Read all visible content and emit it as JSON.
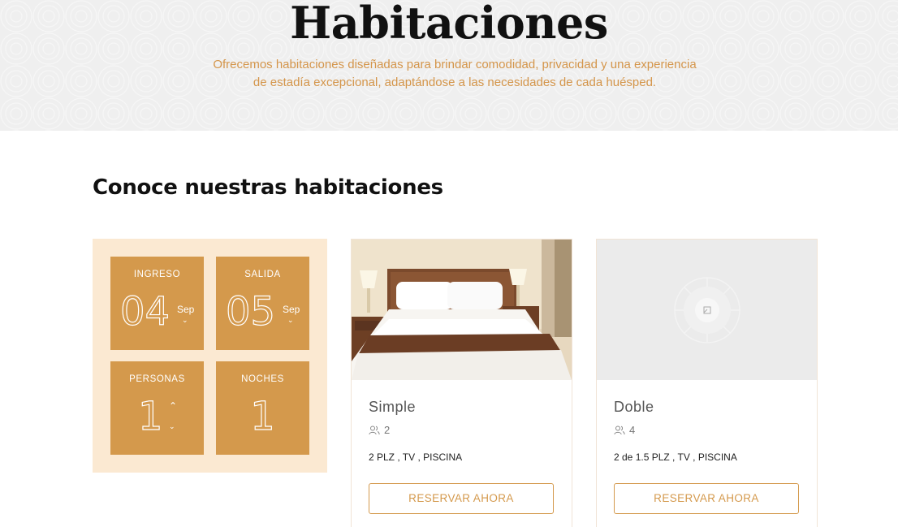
{
  "hero": {
    "title": "Habitaciones",
    "subtitle_line1": "Ofrecemos habitaciones diseñadas para brindar comodidad, privacidad y una experiencia",
    "subtitle_line2": "de estadía excepcional, adaptándose a las necesidades de cada huésped."
  },
  "section": {
    "title": "Conoce nuestras habitaciones"
  },
  "booking": {
    "checkin": {
      "label": "INGRESO",
      "day": "04",
      "month": "Sep"
    },
    "checkout": {
      "label": "SALIDA",
      "day": "05",
      "month": "Sep"
    },
    "guests": {
      "label": "PERSONAS",
      "value": "1"
    },
    "nights": {
      "label": "NOCHES",
      "value": "1"
    }
  },
  "rooms": [
    {
      "name": "Simple",
      "guests": "2",
      "amenities": "2 PLZ , TV , PISCINA",
      "button": "RESERVAR AHORA",
      "image": "hotel-bedroom-photo"
    },
    {
      "name": "Doble",
      "guests": "4",
      "amenities": "2 de 1.5 PLZ , TV , PISCINA",
      "button": "RESERVAR AHORA",
      "image": "image-placeholder-icon"
    }
  ],
  "colors": {
    "accent": "#d4994c",
    "accent_text": "#d4954a",
    "widget_bg": "#fbe9d2"
  }
}
